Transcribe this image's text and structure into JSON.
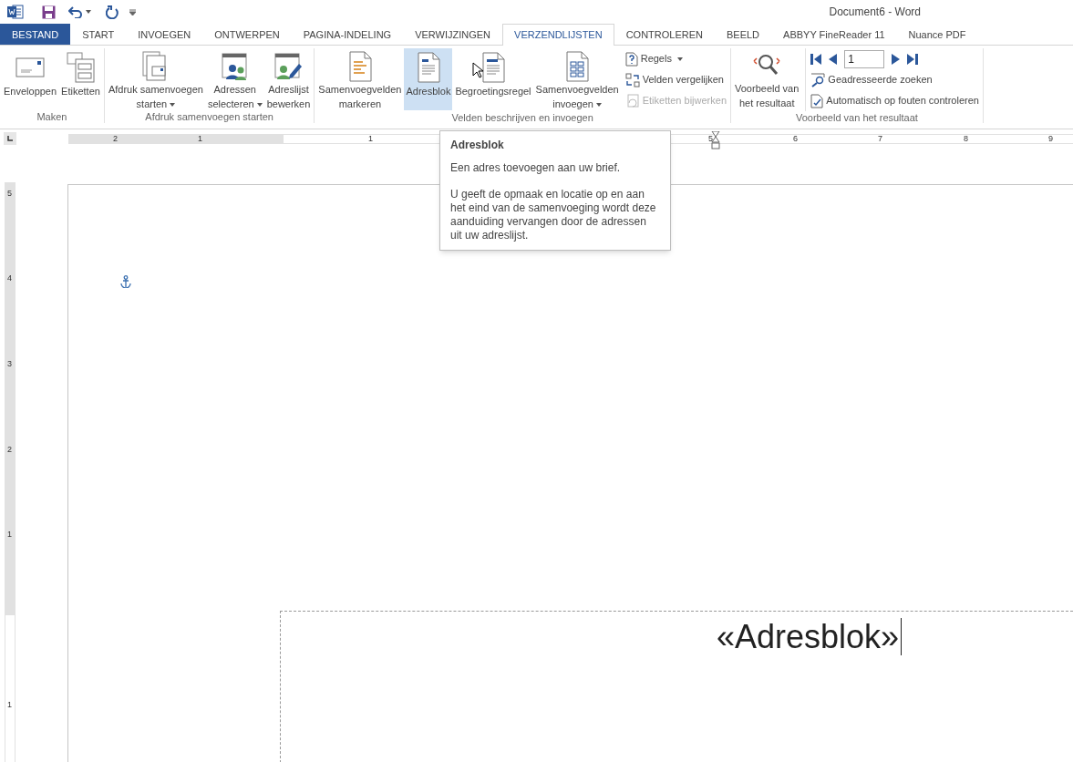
{
  "title_bar": {
    "title": "Document6 - Word"
  },
  "tabs": [
    {
      "label": "BESTAND",
      "kind": "file",
      "selected": false
    },
    {
      "label": "START",
      "kind": "tab",
      "selected": false
    },
    {
      "label": "INVOEGEN",
      "kind": "tab",
      "selected": false
    },
    {
      "label": "ONTWERPEN",
      "kind": "tab",
      "selected": false
    },
    {
      "label": "PAGINA-INDELING",
      "kind": "tab",
      "selected": false
    },
    {
      "label": "VERWIJZINGEN",
      "kind": "tab",
      "selected": false
    },
    {
      "label": "VERZENDLIJSTEN",
      "kind": "tab",
      "selected": true
    },
    {
      "label": "CONTROLEREN",
      "kind": "tab",
      "selected": false
    },
    {
      "label": "BEELD",
      "kind": "tab",
      "selected": false
    },
    {
      "label": "ABBYY FineReader 11",
      "kind": "tab",
      "selected": false
    },
    {
      "label": "Nuance PDF",
      "kind": "tab",
      "selected": false
    }
  ],
  "ribbon": {
    "groups": [
      {
        "label": "Maken",
        "items": [
          {
            "kind": "large",
            "lines": [
              "Enveloppen"
            ],
            "dropdown": false,
            "hovered": false
          },
          {
            "kind": "large",
            "lines": [
              "Etiketten"
            ],
            "dropdown": false,
            "hovered": false
          }
        ]
      },
      {
        "label": "Afdruk samenvoegen starten",
        "items": [
          {
            "kind": "large",
            "lines": [
              "Afdruk samenvoegen",
              "starten"
            ],
            "dropdown": true,
            "hovered": false
          },
          {
            "kind": "large",
            "lines": [
              "Adressen",
              "selecteren"
            ],
            "dropdown": true,
            "hovered": false
          },
          {
            "kind": "large",
            "lines": [
              "Adreslijst",
              "bewerken"
            ],
            "dropdown": false,
            "hovered": false
          }
        ]
      },
      {
        "label": "Velden beschrijven en invoegen",
        "items": [
          {
            "kind": "large",
            "lines": [
              "Samenvoegvelden",
              "markeren"
            ],
            "dropdown": false,
            "hovered": false
          },
          {
            "kind": "large",
            "lines": [
              "Adresblok"
            ],
            "dropdown": false,
            "hovered": true
          },
          {
            "kind": "large",
            "lines": [
              "Begroetingsregel"
            ],
            "dropdown": false,
            "hovered": false
          },
          {
            "kind": "large",
            "lines": [
              "Samenvoegvelden",
              "invoegen"
            ],
            "dropdown": true,
            "hovered": false
          },
          {
            "kind": "smallstack",
            "buttons": [
              {
                "label": "Regels",
                "dropdown": true,
                "disabled": false
              },
              {
                "label": "Velden vergelijken",
                "dropdown": false,
                "disabled": false
              },
              {
                "label": "Etiketten bijwerken",
                "dropdown": false,
                "disabled": true
              }
            ]
          }
        ]
      },
      {
        "label": "Voorbeeld van het resultaat",
        "items": [
          {
            "kind": "large",
            "lines": [
              "Voorbeeld van",
              "het resultaat"
            ],
            "dropdown": false,
            "hovered": false
          },
          {
            "kind": "navstack",
            "record": {
              "value": "1"
            },
            "buttons": [
              {
                "label": "Geadresseerde zoeken",
                "dropdown": false,
                "disabled": false
              },
              {
                "label": "Automatisch op fouten controleren",
                "dropdown": false,
                "disabled": false
              }
            ]
          }
        ]
      }
    ]
  },
  "tooltip": {
    "title": "Adresblok",
    "lines": [
      "Een adres toevoegen aan uw brief.",
      "U geeft de opmaak en locatie op en aan het eind van de samenvoeging wordt deze aanduiding vervangen door de adressen uit uw adreslijst."
    ]
  },
  "horizontal_ruler": {
    "labels": [
      "2",
      "1",
      "1",
      "5",
      "6",
      "7",
      "8",
      "9"
    ]
  },
  "vertical_ruler": {
    "labels": [
      "5",
      "4",
      "3",
      "2",
      "1",
      "1"
    ]
  },
  "document": {
    "field_text": "«Adresblok»"
  }
}
